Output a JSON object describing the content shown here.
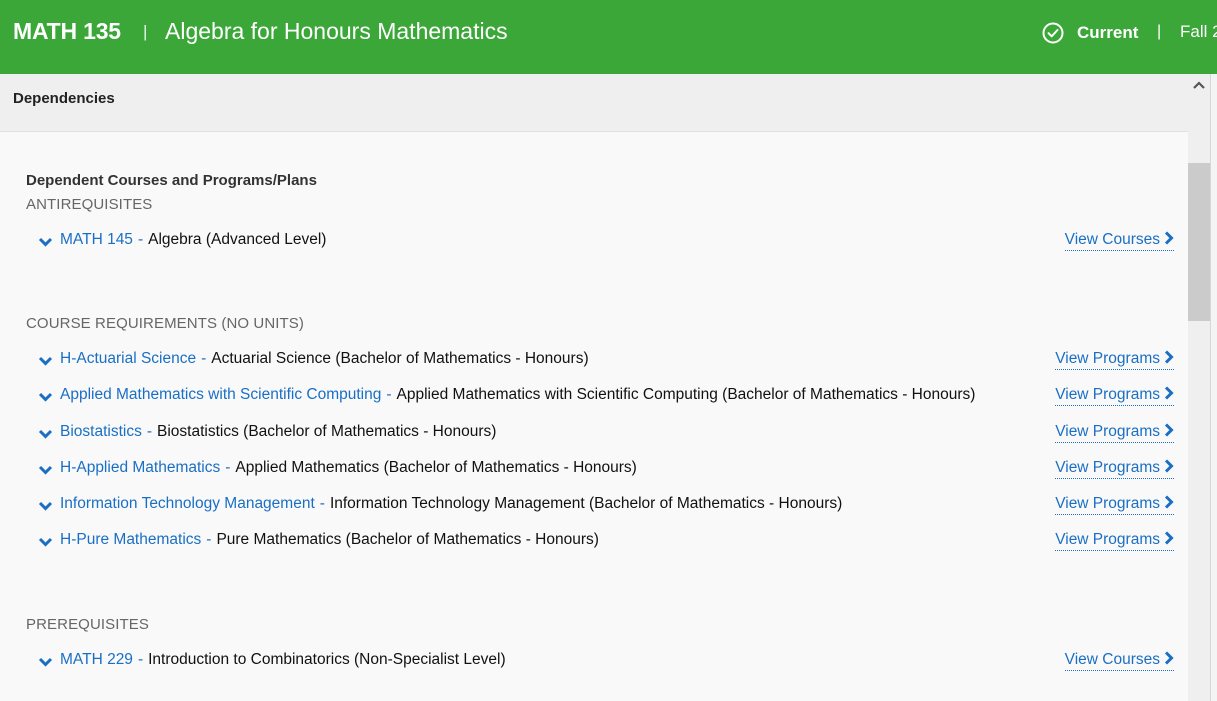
{
  "header": {
    "course_code": "MATH 135",
    "separator": "|",
    "course_title": "Algebra for Honours Mathematics",
    "status_icon": "check-circle-icon",
    "status": "Current",
    "term": "Fall 2"
  },
  "section": {
    "label": "Dependencies",
    "collapse_icon": "chevron-up-icon"
  },
  "dependencies": {
    "subheading": "Dependent Courses and Programs/Plans",
    "groups": [
      {
        "title": "ANTIREQUISITES",
        "items": [
          {
            "code": "MATH 145",
            "dash": "-",
            "name": "Algebra (Advanced Level)",
            "action": "View Courses"
          }
        ]
      },
      {
        "title": "COURSE REQUIREMENTS (NO UNITS)",
        "items": [
          {
            "code": "H-Actuarial Science",
            "dash": "-",
            "name": "Actuarial Science (Bachelor of Mathematics - Honours)",
            "action": "View Programs"
          },
          {
            "code": "Applied Mathematics with Scientific Computing",
            "dash": "-",
            "name": "Applied Mathematics with Scientific Computing (Bachelor of Mathematics - Honours)",
            "action": "View Programs"
          },
          {
            "code": "Biostatistics",
            "dash": "-",
            "name": "Biostatistics (Bachelor of Mathematics - Honours)",
            "action": "View Programs"
          },
          {
            "code": "H-Applied Mathematics",
            "dash": "-",
            "name": "Applied Mathematics (Bachelor of Mathematics - Honours)",
            "action": "View Programs"
          },
          {
            "code": "Information Technology Management",
            "dash": "-",
            "name": "Information Technology Management (Bachelor of Mathematics - Honours)",
            "action": "View Programs"
          },
          {
            "code": "H-Pure Mathematics",
            "dash": "-",
            "name": "Pure Mathematics (Bachelor of Mathematics - Honours)",
            "action": "View Programs"
          }
        ]
      },
      {
        "title": "PREREQUISITES",
        "items": [
          {
            "code": "MATH 229",
            "dash": "-",
            "name": "Introduction to Combinatorics (Non-Specialist Level)",
            "action": "View Courses"
          }
        ]
      }
    ]
  },
  "colors": {
    "header_bg": "#3ba738",
    "link": "#1a6fc4"
  }
}
